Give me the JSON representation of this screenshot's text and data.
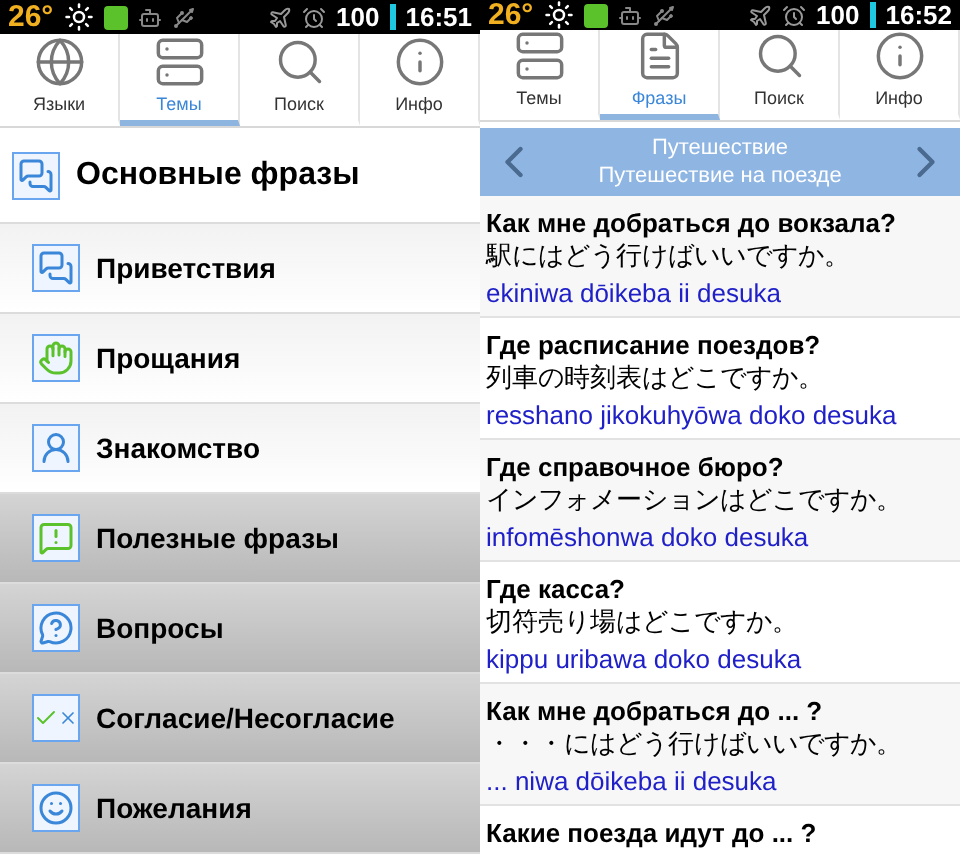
{
  "panes": [
    {
      "status_bar": {
        "temperature": "26°",
        "battery": "100",
        "time": "16:51"
      },
      "tabs": [
        {
          "label": "Языки",
          "selected": false
        },
        {
          "label": "Темы",
          "selected": true
        },
        {
          "label": "Поиск",
          "selected": false
        },
        {
          "label": "Инфо",
          "selected": false
        }
      ],
      "topics": [
        {
          "label": "Основные фразы",
          "kind": "header",
          "highlighted": false
        },
        {
          "label": "Приветствия",
          "kind": "item",
          "highlighted": false
        },
        {
          "label": "Прощания",
          "kind": "item",
          "highlighted": false
        },
        {
          "label": "Знакомство",
          "kind": "item",
          "highlighted": false
        },
        {
          "label": "Полезные фразы",
          "kind": "item",
          "highlighted": true
        },
        {
          "label": "Вопросы",
          "kind": "item",
          "highlighted": true
        },
        {
          "label": "Согласие/Несогласие",
          "kind": "item",
          "highlighted": true
        },
        {
          "label": "Пожелания",
          "kind": "item",
          "highlighted": true
        }
      ]
    },
    {
      "status_bar": {
        "temperature": "26°",
        "battery": "100",
        "time": "16:52"
      },
      "tabs": [
        {
          "label": "Темы",
          "selected": false
        },
        {
          "label": "Фразы",
          "selected": true
        },
        {
          "label": "Поиск",
          "selected": false
        },
        {
          "label": "Инфо",
          "selected": false
        }
      ],
      "category": {
        "title": "Путешествие",
        "subtitle": "Путешествие на поезде"
      },
      "phrases": [
        {
          "ru": "Как мне добраться до вокзала?",
          "ja": "駅にはどう行けばいいですか。",
          "romaji": "ekiniwa dōikeba ii desuka"
        },
        {
          "ru": "Где расписание поездов?",
          "ja": "列車の時刻表はどこですか。",
          "romaji": "resshano jikokuhyōwa doko desuka"
        },
        {
          "ru": "Где справочное бюро?",
          "ja": "インフォメーションはどこですか。",
          "romaji": "infomēshonwa doko desuka"
        },
        {
          "ru": "Где касса?",
          "ja": "切符売り場はどこですか。",
          "romaji": "kippu uribawa doko desuka"
        },
        {
          "ru": "Как мне добраться до ... ?",
          "ja": "・・・にはどう行けばいいですか。",
          "romaji": "... niwa dōikeba ii desuka"
        },
        {
          "ru": "Какие поезда идут до ... ?"
        }
      ]
    }
  ]
}
